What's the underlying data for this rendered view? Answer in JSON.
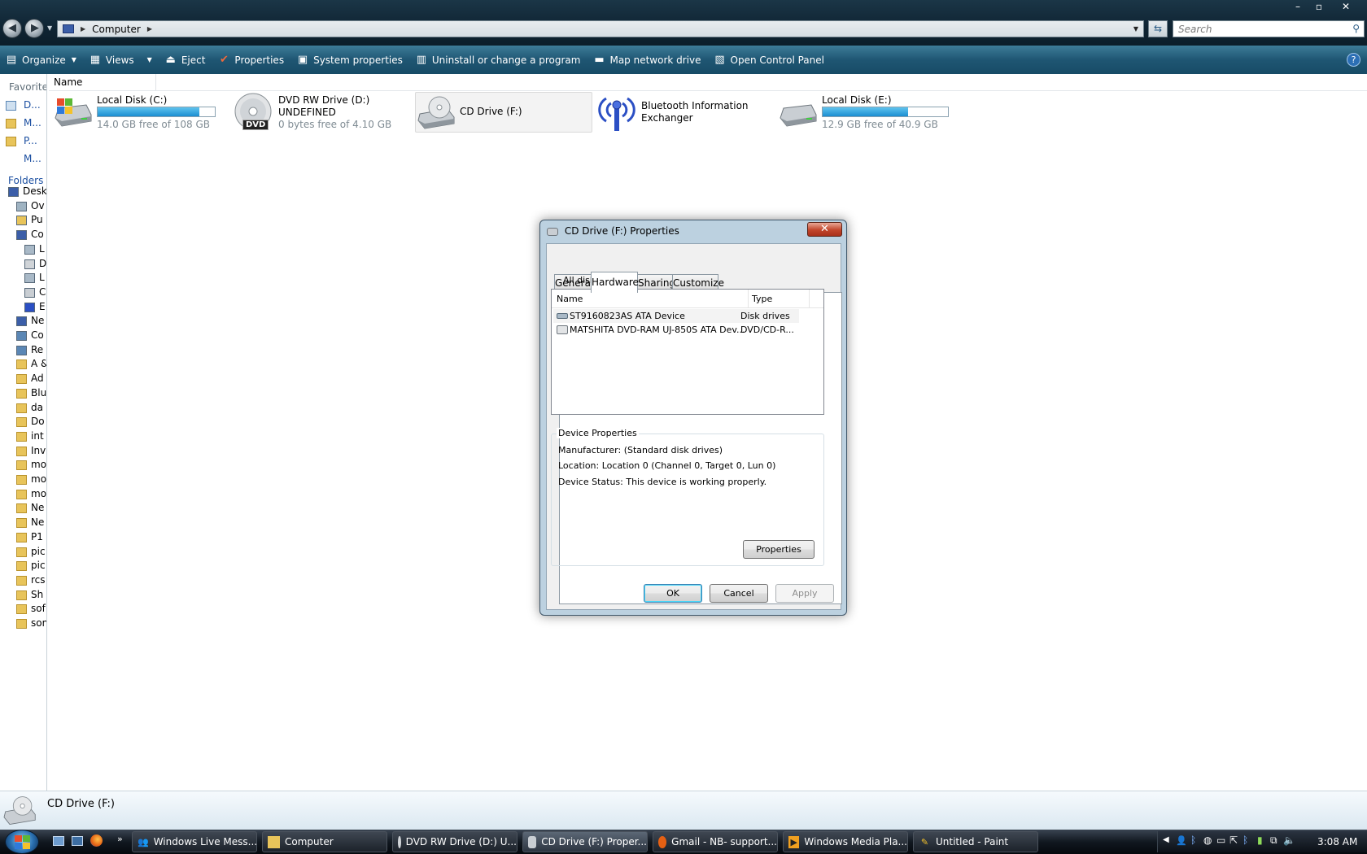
{
  "window": {
    "address": {
      "root": "Computer"
    },
    "search_placeholder": "Search",
    "controls": {
      "minimize": "–",
      "maximize": "▫",
      "close": "✕"
    }
  },
  "toolbar": {
    "organize": "Organize",
    "views": "Views",
    "eject": "Eject",
    "properties": "Properties",
    "system_properties": "System properties",
    "uninstall": "Uninstall or change a program",
    "map_drive": "Map network drive",
    "control_panel": "Open Control Panel"
  },
  "nav": {
    "favorites_header": "Favorite l",
    "favorites": [
      "D...",
      "M...",
      "P...",
      "M..."
    ],
    "folders_header": "Folders",
    "tree": [
      "Desk",
      "Ov",
      "Pu",
      "Co",
      "L",
      "D",
      "L",
      "C",
      "E",
      "Ne",
      "Co",
      "Re",
      "A &",
      "Ad",
      "Blu",
      "da",
      "Do",
      "int",
      "Inv",
      "mo",
      "mo",
      "mo",
      "Ne",
      "Ne",
      "P1",
      "pic",
      "pic",
      "rcs",
      "Sh",
      "sof",
      "son"
    ]
  },
  "content": {
    "column_name": "Name",
    "drives": [
      {
        "name": "Local Disk (C:)",
        "sub": "14.0 GB free of 108 GB",
        "used_fraction": 0.87
      },
      {
        "name": "DVD RW Drive (D:)",
        "name2": "UNDEFINED",
        "sub": "0 bytes free of 4.10 GB",
        "badge": "DVD"
      },
      {
        "name": "CD Drive (F:)"
      },
      {
        "name": "Bluetooth Information",
        "name2": "Exchanger"
      },
      {
        "name": "Local Disk (E:)",
        "sub": "12.9 GB free of 40.9 GB",
        "used_fraction": 0.68
      }
    ]
  },
  "details": {
    "name": "CD Drive (F:)"
  },
  "dialog": {
    "title": "CD Drive (F:) Properties",
    "close": "✕",
    "tabs": [
      "General",
      "Hardware",
      "Sharing",
      "Customize"
    ],
    "selected_tab": "Hardware",
    "all_drives_label": "All disk drives:",
    "columns": {
      "name": "Name",
      "type": "Type"
    },
    "rows": [
      {
        "name": "ST9160823AS ATA Device",
        "type": "Disk drives"
      },
      {
        "name": "MATSHITA DVD-RAM UJ-850S ATA Dev...",
        "type": "DVD/CD-R..."
      }
    ],
    "device_props_title": "Device Properties",
    "manufacturer": "Manufacturer: (Standard disk drives)",
    "location": "Location: Location 0 (Channel 0, Target 0, Lun 0)",
    "status": "Device Status: This device is working properly.",
    "properties_button": "Properties",
    "ok": "OK",
    "cancel": "Cancel",
    "apply": "Apply"
  },
  "taskbar": {
    "items": [
      {
        "label": "Windows Live Mess..."
      },
      {
        "label": "Computer"
      },
      {
        "label": "DVD RW Drive (D:) U..."
      },
      {
        "label": "CD Drive (F:) Proper..."
      },
      {
        "label": "Gmail - NB- support..."
      },
      {
        "label": "Windows Media Pla..."
      },
      {
        "label": "Untitled - Paint"
      }
    ],
    "clock": "3:08 AM"
  }
}
